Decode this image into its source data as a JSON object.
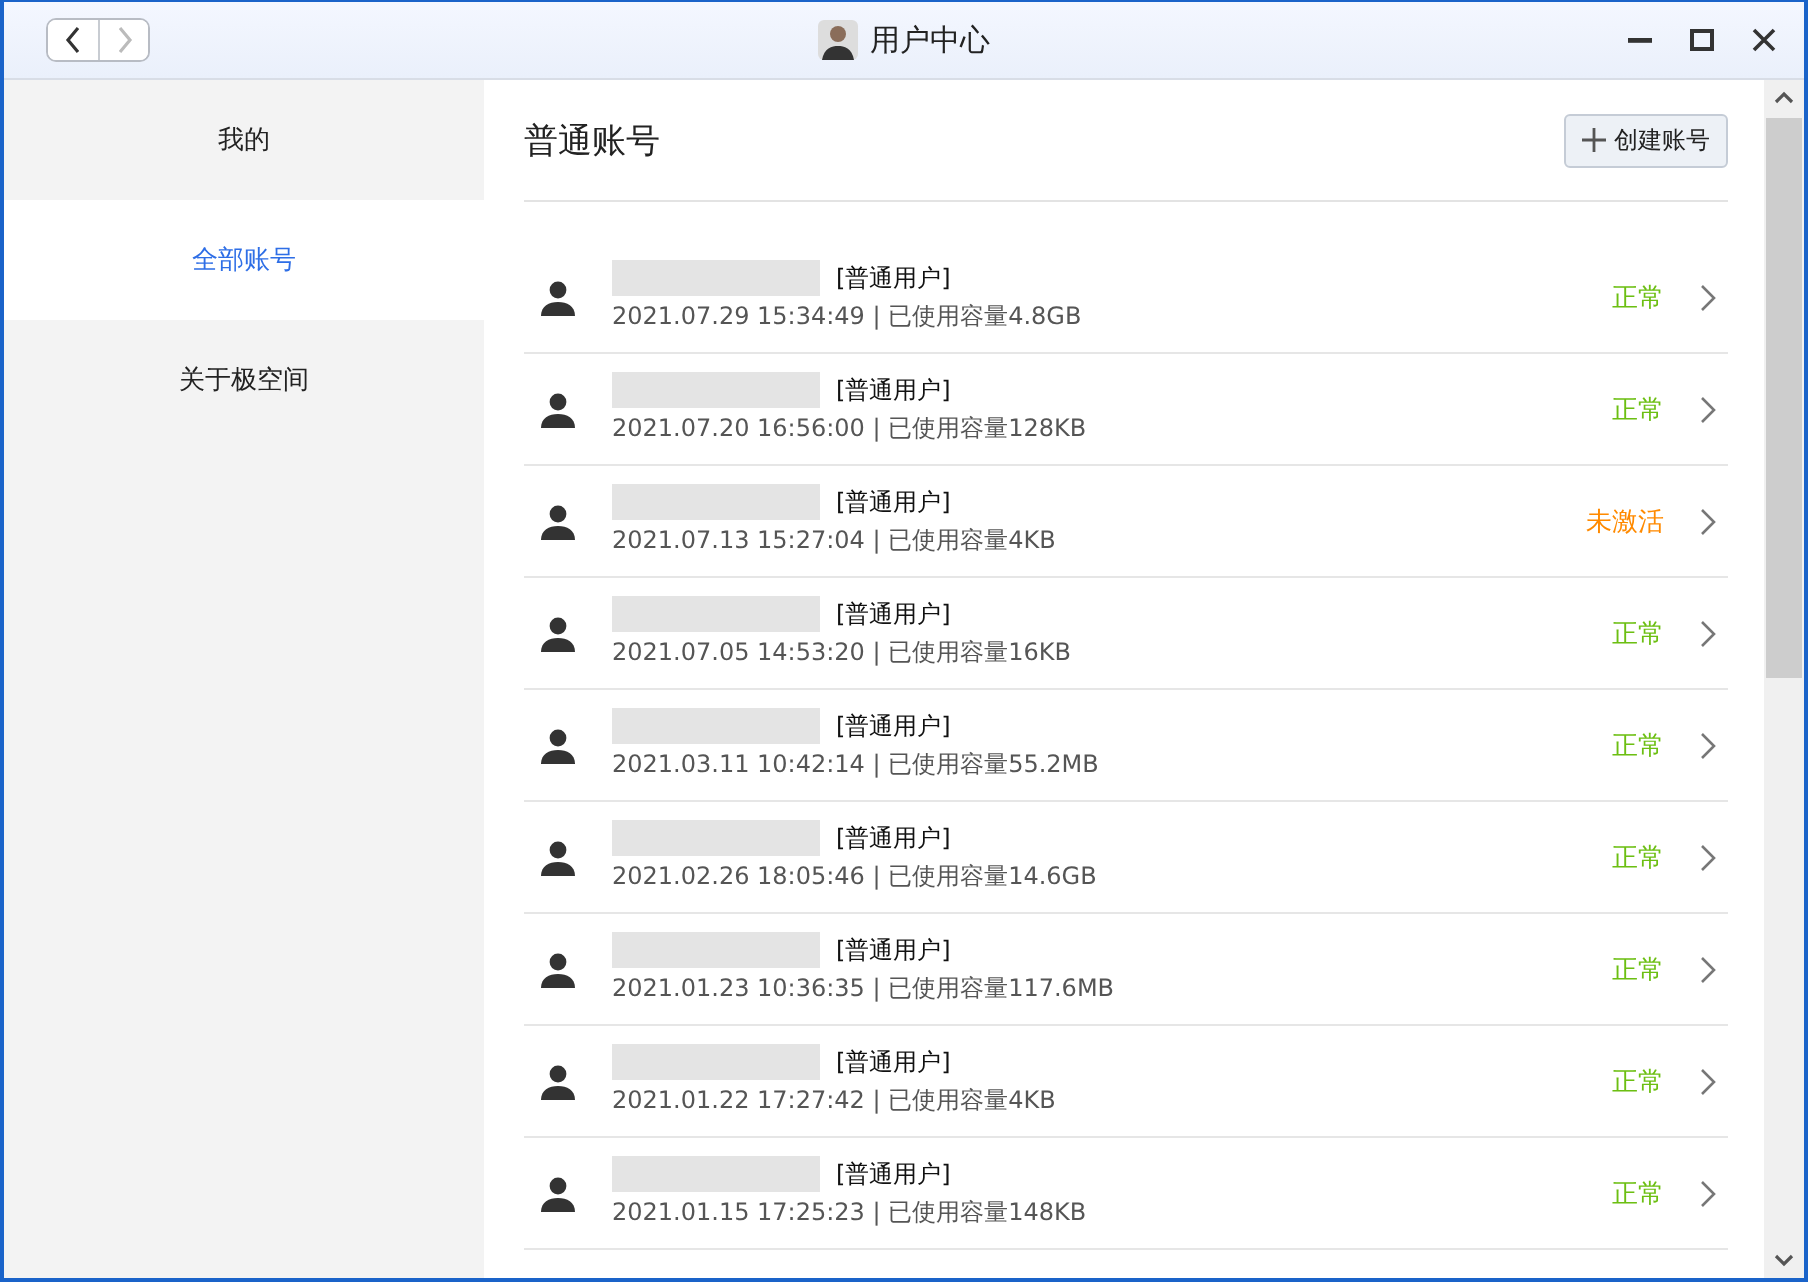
{
  "window": {
    "title": "用户中心"
  },
  "sidebar": {
    "items": [
      {
        "label": "我的",
        "selected": false
      },
      {
        "label": "全部账号",
        "selected": true
      },
      {
        "label": "关于极空间",
        "selected": false
      }
    ]
  },
  "content": {
    "heading": "普通账号",
    "create_button": "创建账号",
    "accounts": [
      {
        "role": "[普通用户]",
        "info": "2021.07.29 15:34:49 | 已使用容量4.8GB",
        "status": "正常",
        "color": "#6cbf12"
      },
      {
        "role": "[普通用户]",
        "info": "2021.07.20 16:56:00 | 已使用容量128KB",
        "status": "正常",
        "color": "#6cbf12"
      },
      {
        "role": "[普通用户]",
        "info": "2021.07.13 15:27:04 | 已使用容量4KB",
        "status": "未激活",
        "color": "#ff8a00"
      },
      {
        "role": "[普通用户]",
        "info": "2021.07.05 14:53:20 | 已使用容量16KB",
        "status": "正常",
        "color": "#6cbf12"
      },
      {
        "role": "[普通用户]",
        "info": "2021.03.11 10:42:14 | 已使用容量55.2MB",
        "status": "正常",
        "color": "#6cbf12"
      },
      {
        "role": "[普通用户]",
        "info": "2021.02.26 18:05:46 | 已使用容量14.6GB",
        "status": "正常",
        "color": "#6cbf12"
      },
      {
        "role": "[普通用户]",
        "info": "2021.01.23 10:36:35 | 已使用容量117.6MB",
        "status": "正常",
        "color": "#6cbf12"
      },
      {
        "role": "[普通用户]",
        "info": "2021.01.22 17:27:42 | 已使用容量4KB",
        "status": "正常",
        "color": "#6cbf12"
      },
      {
        "role": "[普通用户]",
        "info": "2021.01.15 17:25:23 | 已使用容量148KB",
        "status": "正常",
        "color": "#6cbf12"
      }
    ]
  }
}
